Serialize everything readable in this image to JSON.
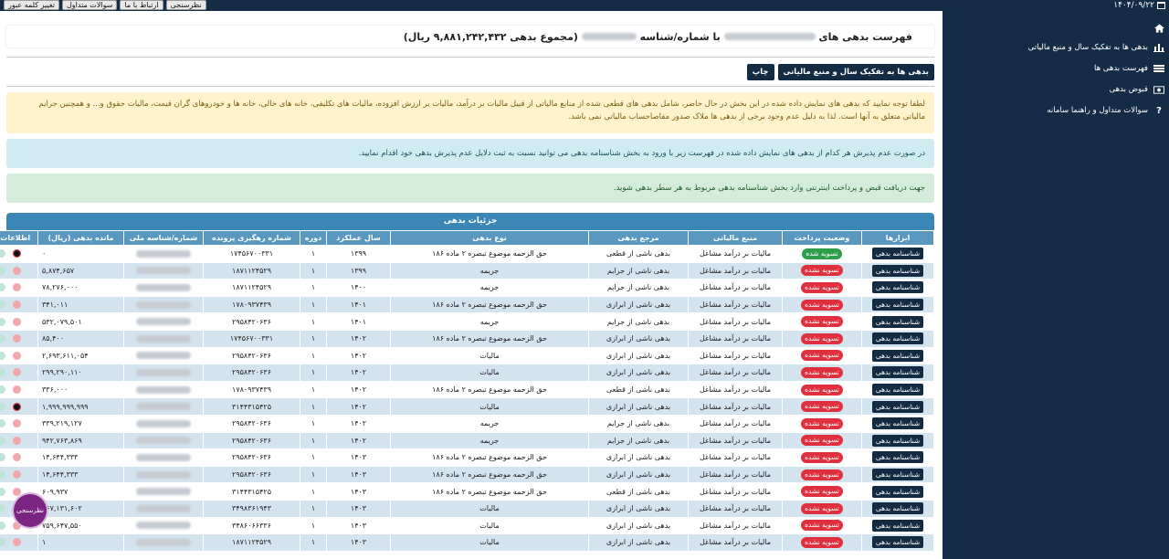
{
  "topbar": {
    "buttons": [
      "نظرسنجی",
      "ارتباط با ما",
      "سوالات متداول",
      "تغییر کلمه عبور"
    ],
    "date": "۱۴۰۴/۰۹/۲۲"
  },
  "sidebar": {
    "items": [
      {
        "label": "بدهی ها به تفکیک سال و منبع مالیاتی",
        "icon": "bar-chart-icon"
      },
      {
        "label": "فهرست بدهی ها",
        "icon": "list-icon"
      },
      {
        "label": "قبوض بدهی",
        "icon": "bill-icon"
      },
      {
        "label": "سوالات متداول و راهنما سامانه",
        "icon": "question-icon"
      }
    ]
  },
  "header": {
    "title_prefix": "فهرست بدهی های",
    "title_middle": "با شماره/شناسه",
    "title_total": "(مجموع بدهی ۹,۸۸۱,۲۴۲,۴۳۲ ریال)"
  },
  "actions": {
    "by_year_source": "بدهی ها به تفکیک سال و منبع مالیاتی",
    "print": "چاپ"
  },
  "alerts": {
    "warning": "لطفا توجه نمایید که بدهی های نمایش داده شده در این بخش در حال حاضر، شامل بدهی های قطعی شده از منابع مالیاتی از قبیل مالیات بر درآمد، مالیات بر ارزش افزوده، مالیات های تکلیفی، خانه های خالی، خانه ها و خودروهای گران قیمت، مالیات حقوق و... و همچنین جرایم مالیاتی متعلق به آنها است. لذا به دلیل عدم وجود برخی از بدهی ها ملاک صدور مفاصاحساب مالیاتی نمی باشد.",
    "info": "در صورت عدم پذیرش هر کدام از بدهی های نمایش داده شده در فهرست زیر با ورود به بخش شناسنامه بدهی می توانید نسبت به ثبت دلایل عدم پذیرش بدهی خود اقدام نمایید.",
    "success": "جهت دریافت قبض و پرداخت اینترنتی وارد بخش شناسنامه بدهی مربوط به هر سطر بدهی شوید."
  },
  "table": {
    "caption": "جزئیات بدهی",
    "columns": [
      "ابزارها",
      "وضعیت پرداخت",
      "منبع مالیاتی",
      "مرجع بدهی",
      "نوع بدهی",
      "سال عملکرد",
      "دوره",
      "شماره رهگیری پرونده",
      "شماره/شناسه ملی",
      "مانده بدهی (ریال)",
      "اطلاعات تکمیلی"
    ],
    "tool_label": "شناسنامه بدهی",
    "rows": [
      {
        "status": "تسویه شده",
        "paid": true,
        "source": "مالیات بر درآمد مشاغل",
        "ref": "بدهی ناشی از قطعی",
        "type": "حق الزحمه موضوع تبصره ۲ ماده ۱۸۶",
        "year": "۱۳۹۹",
        "period": "۱",
        "track": "۱۷۴۵۶۷۰۰۳۳۱",
        "amount": "۰",
        "extra": [
          "rs",
          "g",
          "gr"
        ]
      },
      {
        "status": "تسویه نشده",
        "paid": false,
        "source": "مالیات بر درآمد مشاغل",
        "ref": "بدهی ناشی از جرایم",
        "type": "جریمه",
        "year": "۱۳۹۹",
        "period": "۱",
        "track": "۱۸۷۱۱۲۴۵۲۹",
        "amount": "۵,۸۷۴,۶۵۷",
        "extra": [
          "r",
          "g",
          "gr"
        ]
      },
      {
        "status": "تسویه نشده",
        "paid": false,
        "source": "مالیات بر درآمد مشاغل",
        "ref": "بدهی ناشی از جرایم",
        "type": "جریمه",
        "year": "۱۴۰۰",
        "period": "۱",
        "track": "۱۸۷۱۱۲۴۵۲۹",
        "amount": "۷۸,۲۷۶,۰۰۰",
        "extra": [
          "r",
          "g",
          "gr"
        ]
      },
      {
        "status": "تسویه نشده",
        "paid": false,
        "source": "مالیات بر درآمد مشاغل",
        "ref": "بدهی ناشی از ابرازی",
        "type": "حق الزحمه موضوع تبصره ۲ ماده ۱۸۶",
        "year": "۱۴۰۱",
        "period": "۱",
        "track": "۱۷۸۰۹۳۷۴۳۹",
        "amount": "۳۴۱,۰۱۱",
        "extra": [
          "r",
          "g",
          "gr"
        ]
      },
      {
        "status": "تسویه نشده",
        "paid": false,
        "source": "مالیات بر درآمد مشاغل",
        "ref": "بدهی ناشی از جرایم",
        "type": "جریمه",
        "year": "۱۴۰۱",
        "period": "۱",
        "track": "۲۹۵۸۴۲۰۶۳۶",
        "amount": "۵۳۲,۰۷۹,۵۰۱",
        "extra": [
          "r",
          "g",
          "gr"
        ]
      },
      {
        "status": "تسویه نشده",
        "paid": false,
        "source": "مالیات بر درآمد مشاغل",
        "ref": "بدهی ناشی از ابرازی",
        "type": "حق الزحمه موضوع تبصره ۲ ماده ۱۸۶",
        "year": "۱۴۰۲",
        "period": "۱",
        "track": "۱۷۴۵۶۷۰۰۳۳۱",
        "amount": "۸۵,۴۰۰",
        "extra": [
          "r",
          "g",
          "gr"
        ]
      },
      {
        "status": "تسویه نشده",
        "paid": false,
        "source": "مالیات بر درآمد مشاغل",
        "ref": "بدهی ناشی از ابرازی",
        "type": "مالیات",
        "year": "۱۴۰۲",
        "period": "۱",
        "track": "۲۹۵۸۴۲۰۶۳۶",
        "amount": "۲,۶۹۳,۶۱۱,۰۵۴",
        "extra": [
          "r",
          "g",
          "gr"
        ]
      },
      {
        "status": "تسویه نشده",
        "paid": false,
        "source": "مالیات بر درآمد مشاغل",
        "ref": "بدهی ناشی از ابرازی",
        "type": "مالیات",
        "year": "۱۴۰۲",
        "period": "۱",
        "track": "۲۹۵۸۴۲۰۶۳۶",
        "amount": "۲۹۹,۲۹۰,۱۱۰",
        "extra": [
          "r",
          "g",
          "gr"
        ]
      },
      {
        "status": "تسویه نشده",
        "paid": false,
        "source": "مالیات بر درآمد مشاغل",
        "ref": "بدهی ناشی از قطعی",
        "type": "حق الزحمه موضوع تبصره ۲ ماده ۱۸۶",
        "year": "۱۴۰۲",
        "period": "۱",
        "track": "۱۷۸۰۹۳۷۴۳۹",
        "amount": "۳۳۶,۰۰۰",
        "extra": [
          "r",
          "g",
          "gr"
        ]
      },
      {
        "status": "تسویه نشده",
        "paid": false,
        "source": "مالیات بر درآمد مشاغل",
        "ref": "بدهی ناشی از ابرازی",
        "type": "مالیات",
        "year": "۱۴۰۲",
        "period": "۱",
        "track": "۳۱۴۴۳۱۵۴۲۵",
        "amount": "۱,۹۹۹,۹۹۹,۹۹۹",
        "extra": [
          "rs",
          "g",
          "os"
        ]
      },
      {
        "status": "تسویه نشده",
        "paid": false,
        "source": "مالیات بر درآمد مشاغل",
        "ref": "بدهی ناشی از جرایم",
        "type": "جریمه",
        "year": "۱۴۰۲",
        "period": "۱",
        "track": "۲۹۵۸۴۲۰۶۳۶",
        "amount": "۳۳۹,۲۱۹,۱۲۷",
        "extra": [
          "r",
          "g",
          "gr"
        ]
      },
      {
        "status": "تسویه نشده",
        "paid": false,
        "source": "مالیات بر درآمد مشاغل",
        "ref": "بدهی ناشی از جرایم",
        "type": "جریمه",
        "year": "۱۴۰۲",
        "period": "۱",
        "track": "۲۹۵۸۴۲۰۶۳۶",
        "amount": "۹۴۲,۷۶۳,۸۶۹",
        "extra": [
          "r",
          "g",
          "gr"
        ]
      },
      {
        "status": "تسویه نشده",
        "paid": false,
        "source": "مالیات بر درآمد مشاغل",
        "ref": "بدهی ناشی از ابرازی",
        "type": "حق الزحمه موضوع تبصره ۲ ماده ۱۸۶",
        "year": "۱۴۰۳",
        "period": "۱",
        "track": "۲۹۵۸۴۲۰۶۳۶",
        "amount": "۱۴,۶۴۴,۳۳۳",
        "extra": [
          "r",
          "g",
          "gr"
        ]
      },
      {
        "status": "تسویه نشده",
        "paid": false,
        "source": "مالیات بر درآمد مشاغل",
        "ref": "بدهی ناشی از ابرازی",
        "type": "حق الزحمه موضوع تبصره ۲ ماده ۱۸۶",
        "year": "۱۴۰۳",
        "period": "۱",
        "track": "۲۹۵۸۴۲۰۶۳۶",
        "amount": "۱۴,۶۴۴,۳۳۳",
        "extra": [
          "r",
          "g",
          "gr"
        ]
      },
      {
        "status": "تسویه نشده",
        "paid": false,
        "source": "مالیات بر درآمد مشاغل",
        "ref": "بدهی ناشی از قطعی",
        "type": "حق الزحمه موضوع تبصره ۲ ماده ۱۸۶",
        "year": "۱۴۰۳",
        "period": "۱",
        "track": "۳۱۴۴۳۱۵۴۲۵",
        "amount": "۶۰۹,۹۳۷",
        "extra": [
          "r",
          "g",
          "gr"
        ]
      },
      {
        "status": "تسویه نشده",
        "paid": false,
        "source": "مالیات بر درآمد مشاغل",
        "ref": "بدهی ناشی از ابرازی",
        "type": "مالیات",
        "year": "۱۴۰۳",
        "period": "۱",
        "track": "۳۴۹۸۳۶۱۹۴۳",
        "amount": "۸۶۷,۱۳۱,۶۰۲",
        "extra": [
          "r",
          "g",
          "os"
        ]
      },
      {
        "status": "تسویه نشده",
        "paid": false,
        "source": "مالیات بر درآمد مشاغل",
        "ref": "بدهی ناشی از ابرازی",
        "type": "مالیات",
        "year": "۱۴۰۳",
        "period": "۱",
        "track": "۳۴۸۶۰۶۶۳۳۶",
        "amount": "۷۵۹,۶۴۷,۵۵۰",
        "extra": [
          "r",
          "g",
          "os"
        ]
      },
      {
        "status": "تسویه نشده",
        "paid": false,
        "source": "مالیات بر درآمد مشاغل",
        "ref": "بدهی ناشی از ابرازی",
        "type": "مالیات",
        "year": "۱۴۰۳",
        "period": "۱",
        "track": "۱۸۷۱۱۲۴۵۲۹",
        "amount": "۱",
        "extra": [
          "r",
          "g",
          "gr"
        ]
      }
    ]
  },
  "survey_bubble": "نظرسنجی"
}
